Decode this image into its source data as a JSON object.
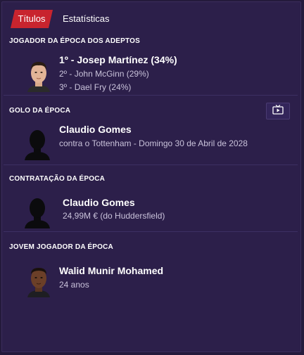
{
  "tabs": {
    "titles": "Títulos",
    "stats": "Estatísticas"
  },
  "fan_player": {
    "heading": "JOGADOR DA ÉPOCA DOS ADEPTOS",
    "first": "1º - Josep Martínez (34%)",
    "second": "2º - John McGinn (29%)",
    "third": "3º - Dael Fry (24%)"
  },
  "goal": {
    "heading": "GOLO DA ÉPOCA",
    "player": "Claudio Gomes",
    "detail": "contra o Tottenham - Domingo 30 de Abril de 2028",
    "video_icon": "tv-play-icon"
  },
  "signing": {
    "heading": "CONTRATAÇÃO DA ÉPOCA",
    "player": "Claudio Gomes",
    "detail": "24,99M € (do Huddersfield)"
  },
  "young_player": {
    "heading": "JOVEM JOGADOR DA ÉPOCA",
    "player": "Walid Munir Mohamed",
    "detail": "24 anos"
  },
  "colors": {
    "background": "#2c1f4a",
    "accent": "#c8242e",
    "divider": "#3d2f63"
  }
}
